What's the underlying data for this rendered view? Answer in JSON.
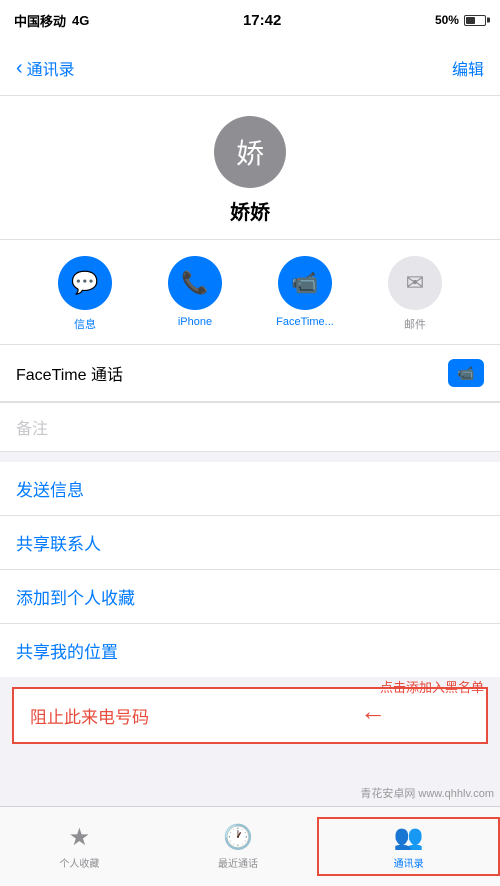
{
  "status": {
    "carrier": "中国移动",
    "network": "4G",
    "time": "17:42",
    "battery": "50%"
  },
  "nav": {
    "back_label": "通讯录",
    "edit_label": "编辑"
  },
  "contact": {
    "avatar_text": "娇",
    "name": "娇娇"
  },
  "actions": [
    {
      "id": "message",
      "icon": "💬",
      "label": "信息",
      "color": "blue"
    },
    {
      "id": "phone",
      "icon": "📞",
      "label": "iPhone",
      "color": "blue"
    },
    {
      "id": "facetime",
      "icon": "📹",
      "label": "FaceTime...",
      "color": "blue"
    },
    {
      "id": "mail",
      "icon": "✉",
      "label": "邮件",
      "color": "gray"
    }
  ],
  "facetime": {
    "title": "FaceTime 通话",
    "icon": "📹"
  },
  "notes": {
    "placeholder": "备注"
  },
  "list_actions": [
    {
      "id": "send-message",
      "label": "发送信息"
    },
    {
      "id": "share-contact",
      "label": "共享联系人"
    },
    {
      "id": "add-favorite",
      "label": "添加到个人收藏"
    },
    {
      "id": "share-location",
      "label": "共享我的位置"
    }
  ],
  "block": {
    "label": "阻止此来电号码"
  },
  "annotation": {
    "text": "点击添加入黑名单"
  },
  "tabs": [
    {
      "id": "favorites",
      "icon": "★",
      "label": "个人收藏",
      "active": false
    },
    {
      "id": "recents",
      "icon": "🕐",
      "label": "最近通话",
      "active": false
    },
    {
      "id": "contacts",
      "icon": "👥",
      "label": "通讯录",
      "active": true
    }
  ],
  "watermark": "青花安卓网 www.qhhlv.com"
}
